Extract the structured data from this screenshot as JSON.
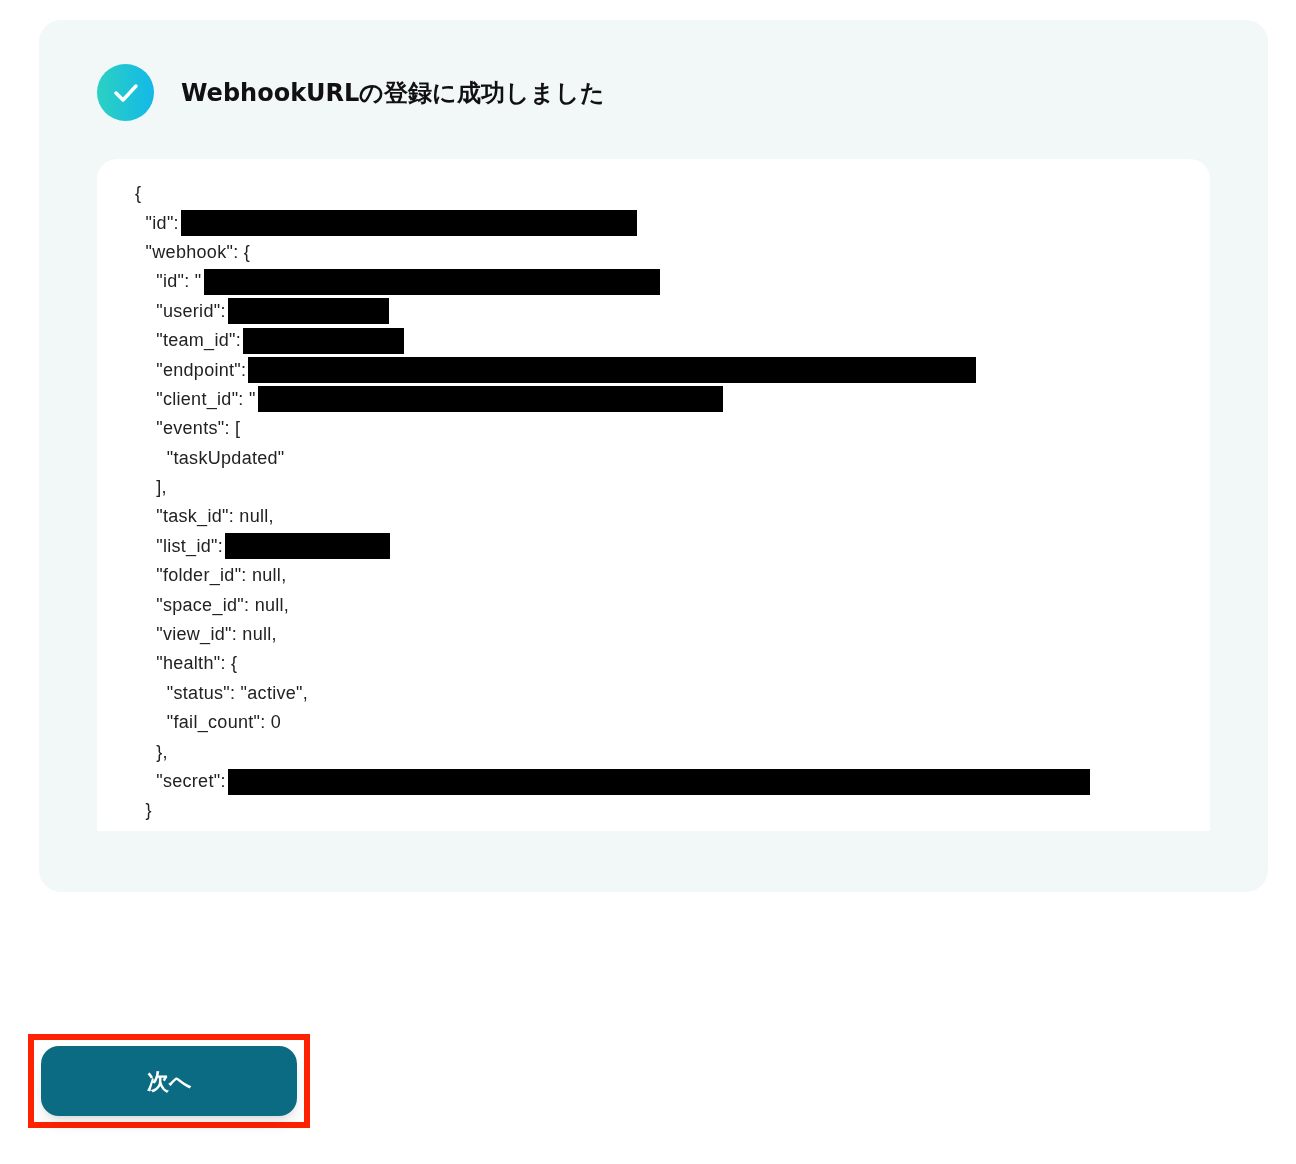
{
  "result": {
    "title": "WebhookURLの登録に成功しました",
    "success": true,
    "code_lines": [
      {
        "text": "{",
        "redacted": false
      },
      {
        "text": "  \"id\":",
        "redacted": true
      },
      {
        "text": "  \"webhook\": {",
        "redacted": false
      },
      {
        "text": "    \"id\": \"",
        "redacted": true
      },
      {
        "text": "    \"userid\":",
        "redacted": true
      },
      {
        "text": "    \"team_id\":",
        "redacted": true
      },
      {
        "text": "    \"endpoint\":",
        "redacted": true
      },
      {
        "text": "    \"client_id\": \"",
        "redacted": true
      },
      {
        "text": "    \"events\": [",
        "redacted": false
      },
      {
        "text": "      \"taskUpdated\"",
        "redacted": false
      },
      {
        "text": "    ],",
        "redacted": false
      },
      {
        "text": "    \"task_id\": null,",
        "redacted": false
      },
      {
        "text": "    \"list_id\":",
        "redacted": true
      },
      {
        "text": "    \"folder_id\": null,",
        "redacted": false
      },
      {
        "text": "    \"space_id\": null,",
        "redacted": false
      },
      {
        "text": "    \"view_id\": null,",
        "redacted": false
      },
      {
        "text": "    \"health\": {",
        "redacted": false
      },
      {
        "text": "      \"status\": \"active\",",
        "redacted": false
      },
      {
        "text": "      \"fail_count\": 0",
        "redacted": false
      },
      {
        "text": "    },",
        "redacted": false
      },
      {
        "text": "    \"secret\":",
        "redacted": true
      },
      {
        "text": "  }",
        "redacted": false
      }
    ]
  },
  "next_button": {
    "label": "次へ",
    "highlighted": true
  }
}
